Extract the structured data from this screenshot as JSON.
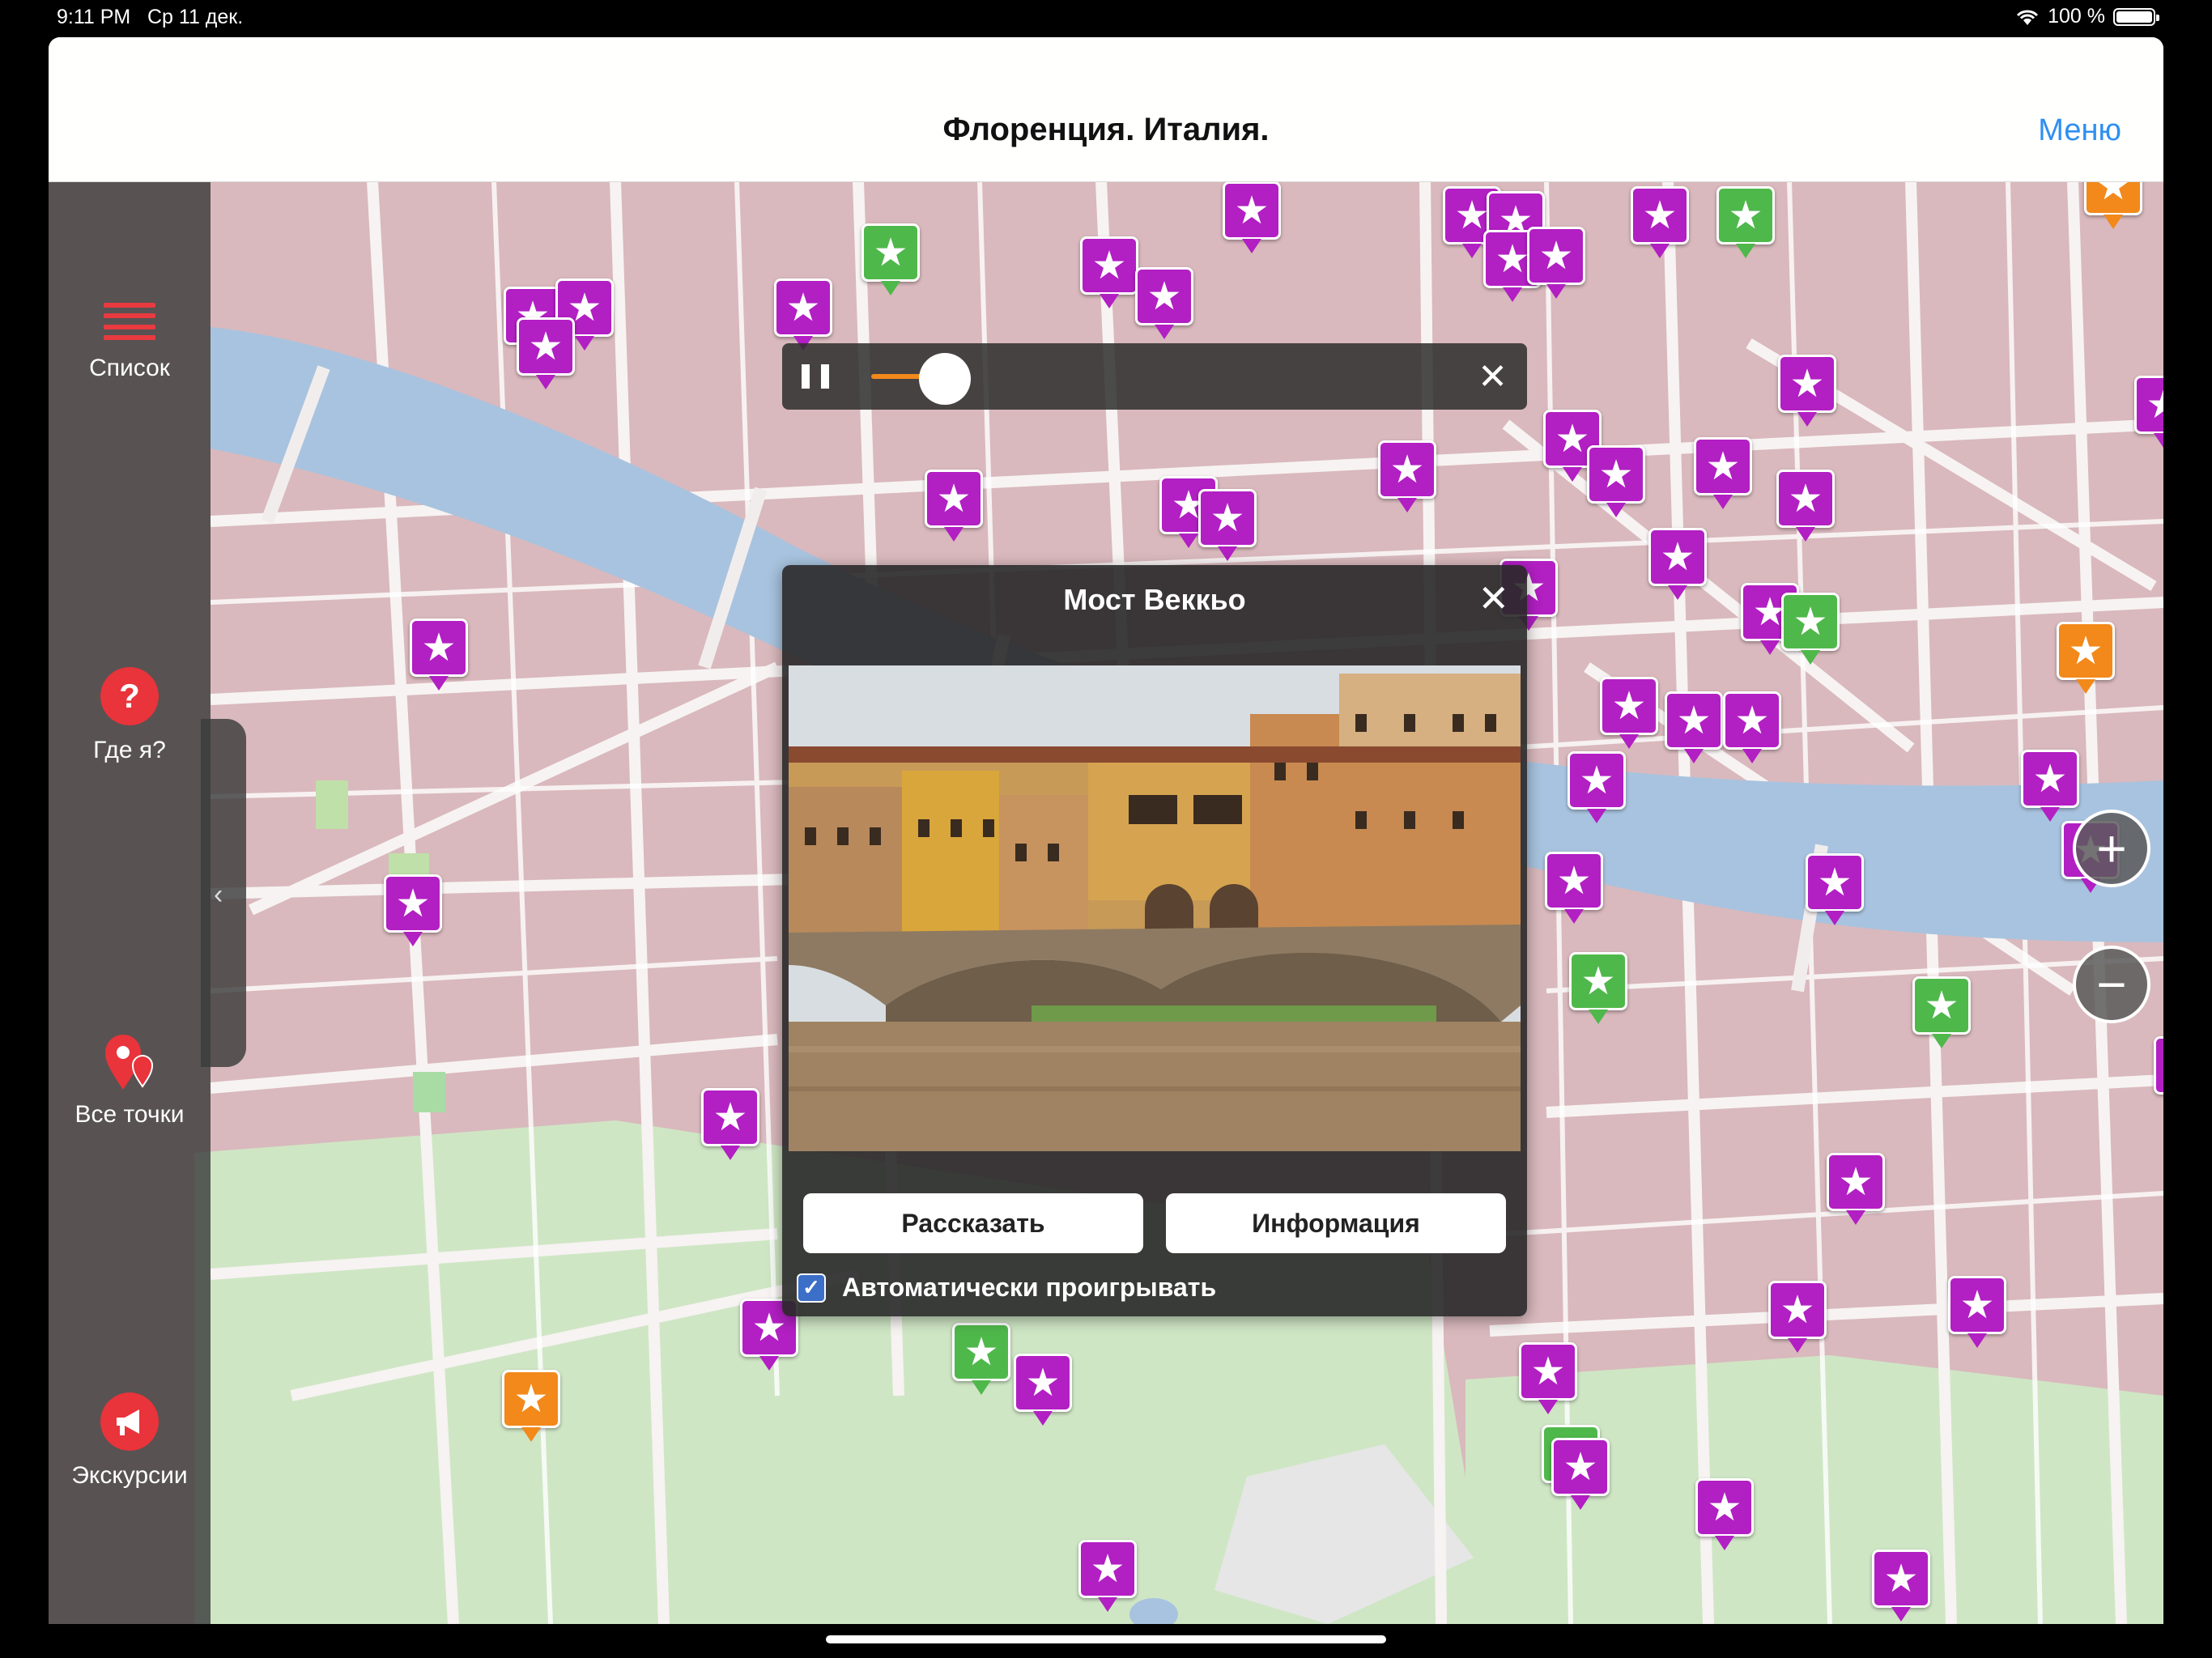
{
  "status_bar": {
    "time": "9:11 PM",
    "date": "Ср 11 дек.",
    "battery": "100 %"
  },
  "navbar": {
    "title": "Флоренция. Италия.",
    "menu_label": "Меню"
  },
  "sidebar": {
    "items": [
      {
        "label": "Список",
        "icon": "list-icon"
      },
      {
        "label": "Где я?",
        "icon": "where-am-i-icon"
      },
      {
        "label": "Все точки",
        "icon": "all-points-icon"
      },
      {
        "label": "Экскурсии",
        "icon": "excursions-icon"
      }
    ]
  },
  "player": {
    "progress": 0.12
  },
  "popup": {
    "title": "Мост Веккьо",
    "tell_button": "Рассказать",
    "info_button": "Информация",
    "autoplay_label": "Автоматически проигрывать",
    "autoplay_checked": true
  },
  "colors": {
    "poi_purple": "#b21fc3",
    "poi_green": "#4fb84b",
    "poi_orange": "#f2891a",
    "accent_blue": "#2f8ff0"
  }
}
